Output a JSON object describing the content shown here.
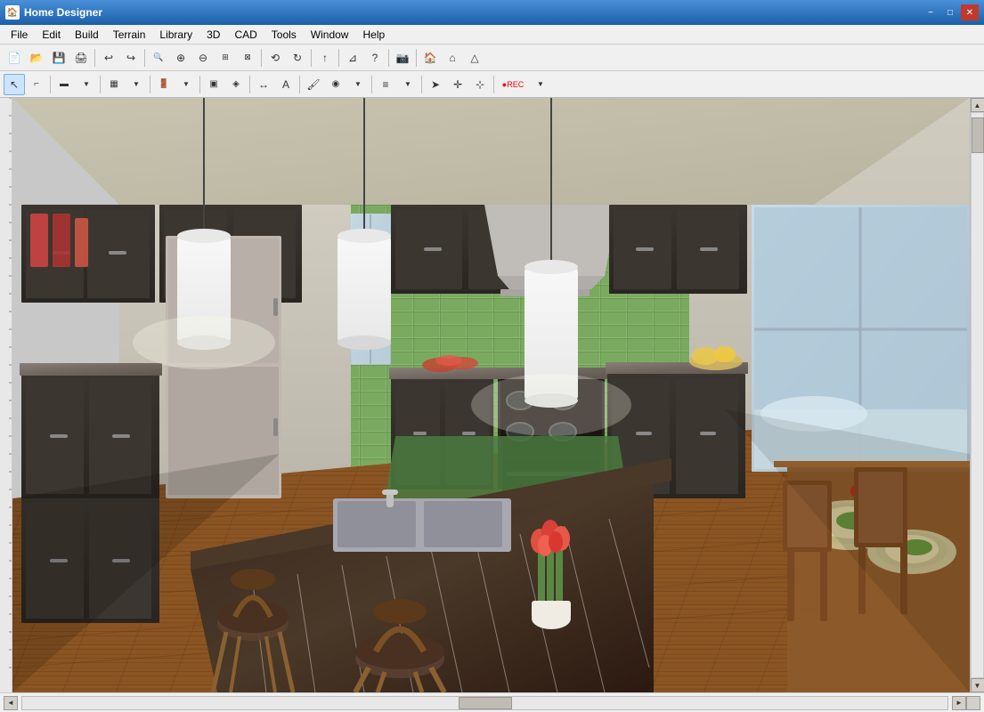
{
  "titlebar": {
    "title": "Home Designer",
    "icon": "🏠",
    "minimize_label": "−",
    "maximize_label": "□",
    "close_label": "✕"
  },
  "menubar": {
    "items": [
      {
        "id": "file",
        "label": "File"
      },
      {
        "id": "edit",
        "label": "Edit"
      },
      {
        "id": "build",
        "label": "Build"
      },
      {
        "id": "terrain",
        "label": "Terrain"
      },
      {
        "id": "library",
        "label": "Library"
      },
      {
        "id": "3d",
        "label": "3D"
      },
      {
        "id": "cad",
        "label": "CAD"
      },
      {
        "id": "tools",
        "label": "Tools"
      },
      {
        "id": "window",
        "label": "Window"
      },
      {
        "id": "help",
        "label": "Help"
      }
    ]
  },
  "toolbar1": {
    "buttons": [
      {
        "id": "new",
        "icon": "📄",
        "title": "New"
      },
      {
        "id": "open",
        "icon": "📂",
        "title": "Open"
      },
      {
        "id": "save",
        "icon": "💾",
        "title": "Save"
      },
      {
        "id": "print",
        "icon": "🖨",
        "title": "Print"
      },
      {
        "id": "undo",
        "icon": "↩",
        "title": "Undo"
      },
      {
        "id": "redo",
        "icon": "↪",
        "title": "Redo"
      },
      {
        "id": "zoom-in",
        "icon": "🔍+",
        "title": "Zoom In"
      },
      {
        "id": "zoom-in2",
        "icon": "⊕",
        "title": "Zoom In"
      },
      {
        "id": "zoom-out",
        "icon": "⊖",
        "title": "Zoom Out"
      },
      {
        "id": "zoom-fit",
        "icon": "⊞",
        "title": "Fit to Screen"
      },
      {
        "id": "zoom-100",
        "icon": "1:1",
        "title": "100%"
      },
      {
        "id": "pan",
        "icon": "✋",
        "title": "Pan"
      },
      {
        "id": "orbit",
        "icon": "⟳",
        "title": "Orbit"
      },
      {
        "id": "arrow-up",
        "icon": "↑",
        "title": "Up"
      },
      {
        "id": "help",
        "icon": "?",
        "title": "Help"
      },
      {
        "id": "camera",
        "icon": "📷",
        "title": "Camera"
      },
      {
        "id": "home",
        "icon": "🏠",
        "title": "Home"
      },
      {
        "id": "house2",
        "icon": "⌂",
        "title": "House"
      },
      {
        "id": "roof",
        "icon": "△",
        "title": "Roof"
      }
    ]
  },
  "toolbar2": {
    "buttons": [
      {
        "id": "select",
        "icon": "↖",
        "title": "Select"
      },
      {
        "id": "polyline",
        "icon": "⌐",
        "title": "Polyline"
      },
      {
        "id": "wall",
        "icon": "⊟",
        "title": "Wall"
      },
      {
        "id": "room",
        "icon": "▦",
        "title": "Room"
      },
      {
        "id": "cabinet",
        "icon": "▣",
        "title": "Cabinet"
      },
      {
        "id": "door",
        "icon": "⬚",
        "title": "Door"
      },
      {
        "id": "fixture",
        "icon": "◈",
        "title": "Fixture"
      },
      {
        "id": "dimension",
        "icon": "↔",
        "title": "Dimension"
      },
      {
        "id": "text",
        "icon": "A",
        "title": "Text"
      },
      {
        "id": "paint",
        "icon": "🖌",
        "title": "Paint"
      },
      {
        "id": "material",
        "icon": "◉",
        "title": "Material"
      },
      {
        "id": "stairs",
        "icon": "≡",
        "title": "Stairs"
      },
      {
        "id": "arrow",
        "icon": "➤",
        "title": "Arrow"
      },
      {
        "id": "move",
        "icon": "✛",
        "title": "Move"
      },
      {
        "id": "rec",
        "icon": "●REC",
        "title": "Record"
      }
    ]
  },
  "viewport": {
    "scene_description": "3D kitchen interior rendering showing dark cabinets, granite countertops, pendant lights, hardwood floors, green tile backsplash, kitchen island with sink"
  },
  "statusbar": {
    "text": ""
  }
}
